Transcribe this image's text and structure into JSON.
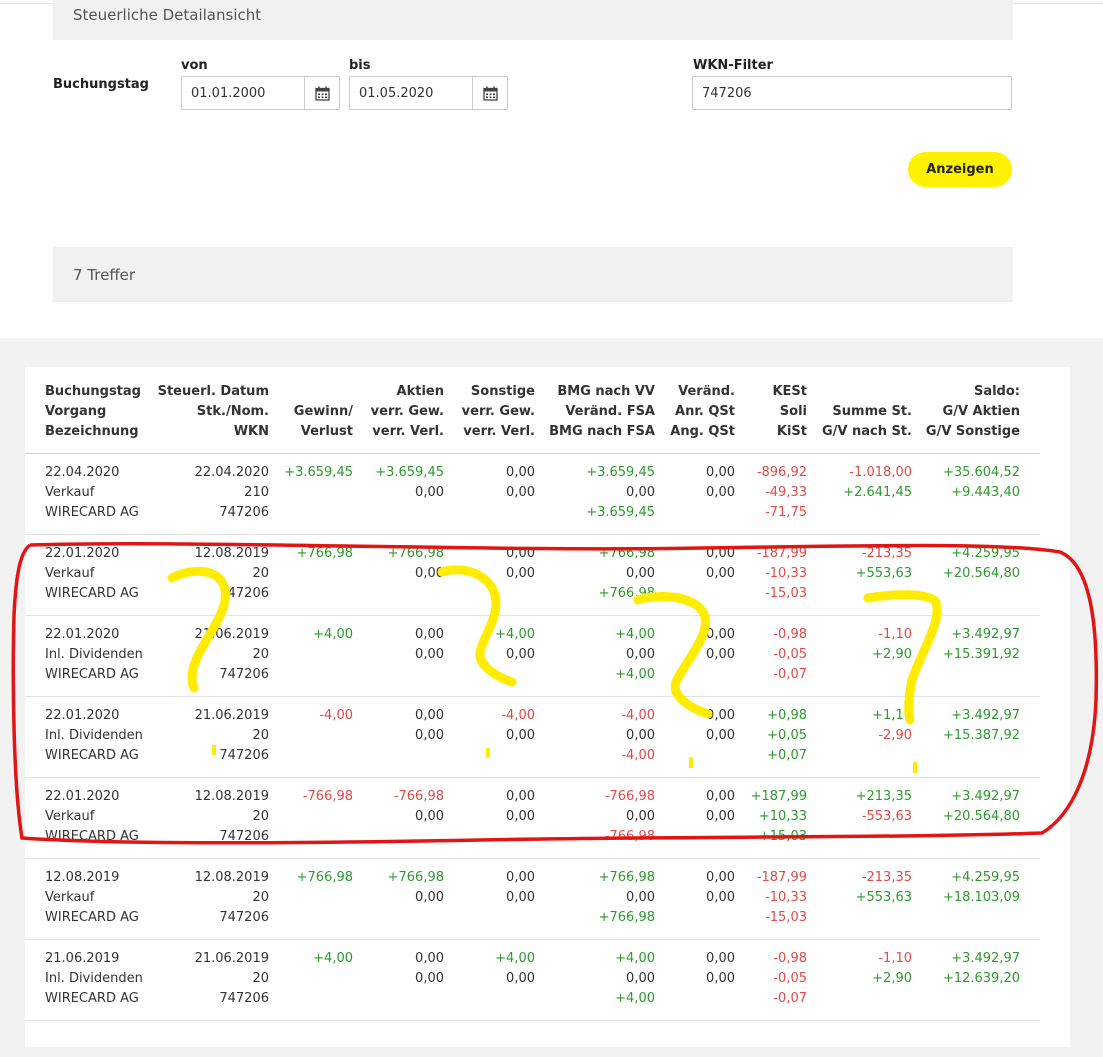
{
  "title": "Steuerliche Detailansicht",
  "filter": {
    "booking_label": "Buchungstag",
    "from_label": "von",
    "from_value": "01.01.2000",
    "to_label": "bis",
    "to_value": "01.05.2020",
    "wkn_label": "WKN-Filter",
    "wkn_value": "747206",
    "show_button": "Anzeigen"
  },
  "results_label": "7 Treffer",
  "columns": [
    [
      "Buchungstag",
      "Vorgang",
      "Bezeichnung"
    ],
    [
      "Steuerl. Datum",
      "Stk./Nom.",
      "WKN"
    ],
    [
      "Gewinn/",
      "Verlust"
    ],
    [
      "Aktien",
      "verr. Gew.",
      "verr. Verl."
    ],
    [
      "Sonstige",
      "verr. Gew.",
      "verr. Verl."
    ],
    [
      "BMG nach VV",
      "Veränd. FSA",
      "BMG nach FSA"
    ],
    [
      "Veränd.",
      "Anr. QSt",
      "Ang. QSt"
    ],
    [
      "KESt",
      "Soli",
      "KiSt"
    ],
    [
      "Summe St.",
      "G/V nach St."
    ],
    [
      "Saldo:",
      "G/V Aktien",
      "G/V Sonstige"
    ]
  ],
  "rows": [
    [
      [
        "22.04.2020",
        "Verkauf",
        "WIRECARD AG"
      ],
      [
        "22.04.2020",
        "210",
        "747206"
      ],
      [
        "+3.659,45"
      ],
      [
        "+3.659,45",
        "0,00"
      ],
      [
        "0,00",
        "0,00"
      ],
      [
        "+3.659,45",
        "0,00",
        "+3.659,45"
      ],
      [
        "0,00",
        "0,00"
      ],
      [
        "-896,92",
        "-49,33",
        "-71,75"
      ],
      [
        "-1.018,00",
        "+2.641,45"
      ],
      [
        "+35.604,52",
        "+9.443,40"
      ]
    ],
    [
      [
        "22.01.2020",
        "Verkauf",
        "WIRECARD AG"
      ],
      [
        "12.08.2019",
        "20",
        "747206"
      ],
      [
        "+766,98"
      ],
      [
        "+766,98",
        "0,00"
      ],
      [
        "0,00",
        "0,00"
      ],
      [
        "+766,98",
        "0,00",
        "+766,98"
      ],
      [
        "0,00",
        "0,00"
      ],
      [
        "-187,99",
        "-10,33",
        "-15,03"
      ],
      [
        "-213,35",
        "+553,63"
      ],
      [
        "+4.259,95",
        "+20.564,80"
      ]
    ],
    [
      [
        "22.01.2020",
        "Inl. Dividenden",
        "WIRECARD AG"
      ],
      [
        "21.06.2019",
        "20",
        "747206"
      ],
      [
        "+4,00"
      ],
      [
        "0,00",
        "0,00"
      ],
      [
        "+4,00",
        "0,00"
      ],
      [
        "+4,00",
        "0,00",
        "+4,00"
      ],
      [
        "0,00",
        "0,00"
      ],
      [
        "-0,98",
        "-0,05",
        "-0,07"
      ],
      [
        "-1,10",
        "+2,90"
      ],
      [
        "+3.492,97",
        "+15.391,92"
      ]
    ],
    [
      [
        "22.01.2020",
        "Inl. Dividenden",
        "WIRECARD AG"
      ],
      [
        "21.06.2019",
        "20",
        "747206"
      ],
      [
        "-4,00"
      ],
      [
        "0,00",
        "0,00"
      ],
      [
        "-4,00",
        "0,00"
      ],
      [
        "-4,00",
        "0,00",
        "-4,00"
      ],
      [
        "0,00",
        "0,00"
      ],
      [
        "+0,98",
        "+0,05",
        "+0,07"
      ],
      [
        "+1,10",
        "-2,90"
      ],
      [
        "+3.492,97",
        "+15.387,92"
      ]
    ],
    [
      [
        "22.01.2020",
        "Verkauf",
        "WIRECARD AG"
      ],
      [
        "12.08.2019",
        "20",
        "747206"
      ],
      [
        "-766,98"
      ],
      [
        "-766,98",
        "0,00"
      ],
      [
        "0,00",
        "0,00"
      ],
      [
        "-766,98",
        "0,00",
        "-766,98"
      ],
      [
        "0,00",
        "0,00"
      ],
      [
        "+187,99",
        "+10,33",
        "+15,03"
      ],
      [
        "+213,35",
        "-553,63"
      ],
      [
        "+3.492,97",
        "+20.564,80"
      ]
    ],
    [
      [
        "12.08.2019",
        "Verkauf",
        "WIRECARD AG"
      ],
      [
        "12.08.2019",
        "20",
        "747206"
      ],
      [
        "+766,98"
      ],
      [
        "+766,98",
        "0,00"
      ],
      [
        "0,00",
        "0,00"
      ],
      [
        "+766,98",
        "0,00",
        "+766,98"
      ],
      [
        "0,00",
        "0,00"
      ],
      [
        "-187,99",
        "-10,33",
        "-15,03"
      ],
      [
        "-213,35",
        "+553,63"
      ],
      [
        "+4.259,95",
        "+18.103,09"
      ]
    ],
    [
      [
        "21.06.2019",
        "Inl. Dividenden",
        "WIRECARD AG"
      ],
      [
        "21.06.2019",
        "20",
        "747206"
      ],
      [
        "+4,00"
      ],
      [
        "0,00",
        "0,00"
      ],
      [
        "+4,00",
        "0,00"
      ],
      [
        "+4,00",
        "0,00",
        "+4,00"
      ],
      [
        "0,00",
        "0,00"
      ],
      [
        "-0,98",
        "-0,05",
        "-0,07"
      ],
      [
        "-1,10",
        "+2,90"
      ],
      [
        "+3.492,97",
        "+12.639,20"
      ]
    ]
  ],
  "colors": {
    "accent_button": "#fff200",
    "positive": "#2e9a2e",
    "negative": "#e04a4a",
    "annotation_red": "#e31414",
    "annotation_yellow": "#ffec00"
  }
}
